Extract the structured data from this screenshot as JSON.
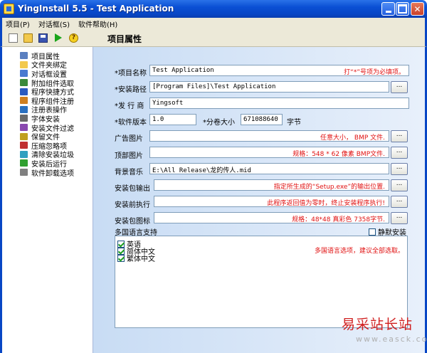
{
  "window": {
    "title": "YingInstall 5.5 - Test Application"
  },
  "menu": {
    "items": [
      "项目(P)",
      "对话框(S)",
      "软件帮助(H)"
    ]
  },
  "toolbar": {
    "section_title": "项目属性",
    "icons": [
      "new-icon",
      "open-icon",
      "save-icon",
      "run-icon",
      "help-icon"
    ]
  },
  "sidebar": {
    "items": [
      {
        "label": "项目属性",
        "icon": "grid-icon",
        "color": "#5a7fc0"
      },
      {
        "label": "文件夹绑定",
        "icon": "folder-icon",
        "color": "#f2c94c"
      },
      {
        "label": "对话框设置",
        "icon": "window-icon",
        "color": "#4a7ad0"
      },
      {
        "label": "附加组件选取",
        "icon": "component-icon",
        "color": "#3a8a3a"
      },
      {
        "label": "程序快捷方式",
        "icon": "shortcut-icon",
        "color": "#2a5ac0"
      },
      {
        "label": "程序组件注册",
        "icon": "register-icon",
        "color": "#d08020"
      },
      {
        "label": "注册表操作",
        "icon": "registry-icon",
        "color": "#2a70c0"
      },
      {
        "label": "字体安装",
        "icon": "font-icon",
        "color": "#6a6a6a"
      },
      {
        "label": "安装文件过滤",
        "icon": "filter-icon",
        "color": "#8a4ab0"
      },
      {
        "label": "保留文件",
        "icon": "keep-file-icon",
        "color": "#c0a020"
      },
      {
        "label": "压缩忽略项",
        "icon": "compress-icon",
        "color": "#c03030"
      },
      {
        "label": "清除安装垃圾",
        "icon": "clean-icon",
        "color": "#30a0c0"
      },
      {
        "label": "安装后运行",
        "icon": "run-after-icon",
        "color": "#30a030"
      },
      {
        "label": "软件卸载选项",
        "icon": "uninstall-icon",
        "color": "#808080"
      }
    ]
  },
  "form": {
    "project_name": {
      "label": "*项目名称",
      "value": "Test Application",
      "hint": "打“*”号项为必填项。"
    },
    "install_path": {
      "label": "*安装路径",
      "value": "[Program Files]\\Test Application",
      "browse": "..."
    },
    "publisher": {
      "label": "*发 行 商",
      "value": "Yingsoft"
    },
    "version": {
      "label": "*软件版本",
      "value": "1.0"
    },
    "volume_size": {
      "label": "*分卷大小",
      "value": "671088640",
      "unit": "字节"
    },
    "ad_image": {
      "label": "广告图片",
      "value": "",
      "hint": "任意大小， BMP 文件.",
      "browse": "..."
    },
    "top_image": {
      "label": "顶部图片",
      "value": "",
      "hint": "规格：548 * 62 像素 BMP文件.",
      "browse": "..."
    },
    "bg_music": {
      "label": "背景音乐",
      "value": "E:\\All Release\\龙的传人.mid",
      "browse": "..."
    },
    "output": {
      "label": "安装包输出",
      "value": "",
      "hint": "指定所生成的“Setup.exe”的输出位置.",
      "browse": "..."
    },
    "pre_exec": {
      "label": "安装前执行",
      "value": "",
      "hint": "此程序返回值为零时，终止安装程序执行!",
      "browse": "..."
    },
    "package_icon": {
      "label": "安装包图标",
      "value": "",
      "hint": "规格：48*48 真彩色 7358字节.",
      "browse": "..."
    },
    "multilang": {
      "label": "多国语言支持",
      "silent_label": "静默安装",
      "silent_checked": false,
      "hint": "多国语言选项，建议全部选取。",
      "languages": [
        {
          "label": "英语",
          "checked": true
        },
        {
          "label": "简体中文",
          "checked": true
        },
        {
          "label": "繁体中文",
          "checked": true
        }
      ]
    }
  },
  "watermark": {
    "cn": "易采站长站",
    "en": "www.easck.com"
  }
}
